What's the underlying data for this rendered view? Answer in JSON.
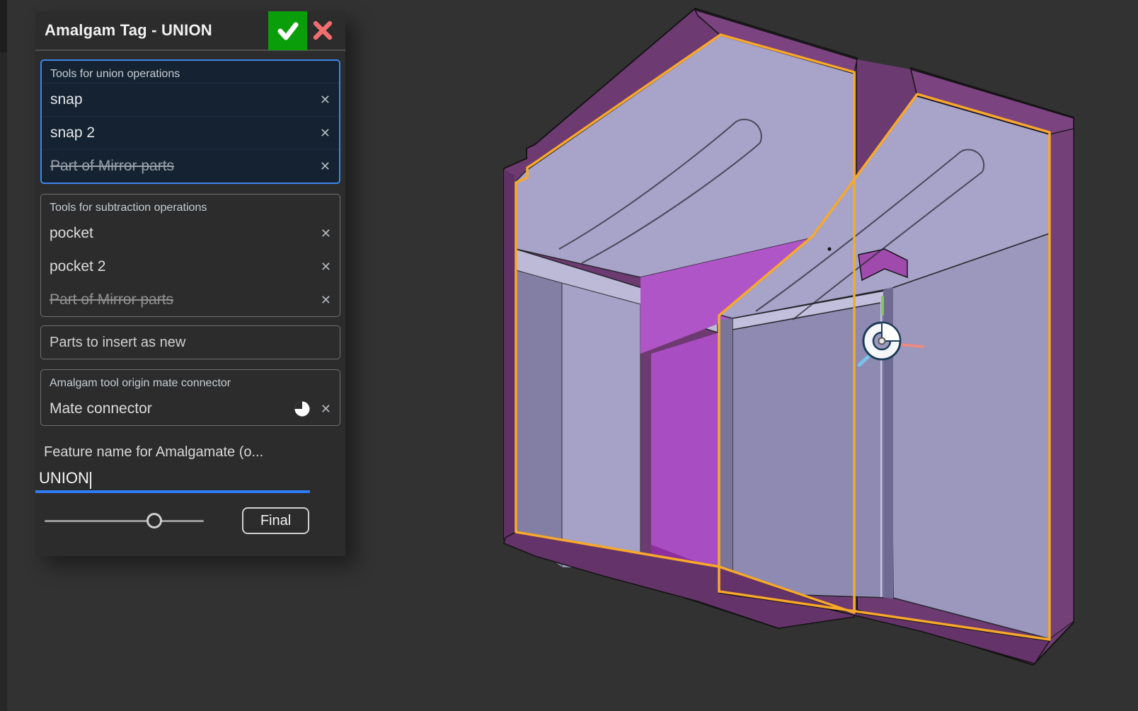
{
  "window": {
    "background": "#323232",
    "left_strip_color": "#272727"
  },
  "dialog": {
    "title": "Amalgam Tag - UNION",
    "accept_button": {
      "icon": "checkmark-icon",
      "color": "#0b9e0b"
    },
    "close_button": {
      "icon": "x-icon",
      "color": "#ef6e6e"
    },
    "remove_icon": "✕",
    "sections": [
      {
        "label": "Tools for union operations",
        "focused": true,
        "items": [
          {
            "name": "snap",
            "excluded": false
          },
          {
            "name": "snap 2",
            "excluded": false
          },
          {
            "name": "Part of Mirror parts",
            "excluded": true
          }
        ]
      },
      {
        "label": "Tools for subtraction operations",
        "focused": false,
        "items": [
          {
            "name": "pocket",
            "excluded": false
          },
          {
            "name": "pocket 2",
            "excluded": false
          },
          {
            "name": "Part of Mirror parts",
            "excluded": true
          }
        ]
      },
      {
        "label": "Parts to insert as new",
        "focused": false,
        "items": []
      },
      {
        "label": "Amalgam tool origin mate connector",
        "focused": false,
        "items": [
          {
            "name": "Mate connector",
            "excluded": false,
            "icon": "mate-connector-pie-icon"
          }
        ]
      }
    ],
    "feature_name_label": "Feature name for Amalgamate (o...",
    "feature_name_value": "UNION",
    "slider": {
      "percent": 69
    },
    "final_button_label": "Final",
    "colors": {
      "dialog_bg": "#2c2c2c",
      "focused_border": "#3d86e8",
      "focused_bg": "#152231",
      "section_border": "#707070",
      "underline_blue": "#2e7cf6"
    }
  },
  "viewport": {
    "colors": {
      "background": "#323232",
      "body_lavender": "#a7a3c9",
      "body_mid": "#908cb3",
      "body_dark": "#7b779e",
      "ghost_plum": "#6d3a72",
      "plum_edge": "#7b4380",
      "magenta": "#a84ec2",
      "outline_orange": "#f8a82a",
      "edge_black": "#141414",
      "axis_green": "#82c95c",
      "axis_red": "#ea8a80",
      "axis_blue": "#79c2ea",
      "gizmo_white": "#ffffff"
    }
  }
}
